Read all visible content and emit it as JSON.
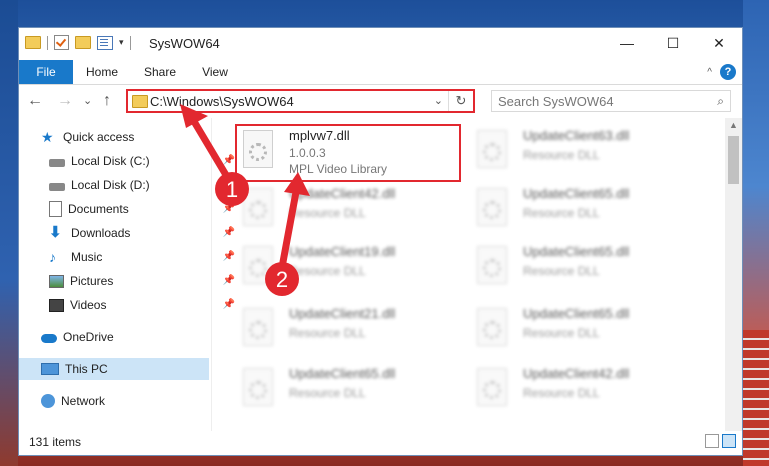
{
  "window": {
    "title": "SysWOW64",
    "minimize_glyph": "—",
    "maximize_glyph": "☐",
    "close_glyph": "✕"
  },
  "ribbon": {
    "tabs": [
      "File",
      "Home",
      "Share",
      "View"
    ],
    "help_glyph": "?",
    "collapse_glyph": "^"
  },
  "nav": {
    "back_glyph": "←",
    "forward_glyph": "→",
    "recent_glyph": "⌄",
    "up_glyph": "↑",
    "address": "C:\\Windows\\SysWOW64",
    "address_chevron": "⌄",
    "refresh_glyph": "↻",
    "search_placeholder": "Search SysWOW64",
    "search_glyph": "⌕"
  },
  "sidebar": {
    "items": [
      {
        "label": "Quick access",
        "icon": "star-icon"
      },
      {
        "label": "Local Disk (C:)",
        "icon": "disk-icon",
        "pinned": true
      },
      {
        "label": "Local Disk (D:)",
        "icon": "disk-icon",
        "pinned": true
      },
      {
        "label": "Documents",
        "icon": "document-icon",
        "pinned": true
      },
      {
        "label": "Downloads",
        "icon": "download-icon",
        "pinned": true
      },
      {
        "label": "Music",
        "icon": "music-icon",
        "pinned": true
      },
      {
        "label": "Pictures",
        "icon": "pictures-icon",
        "pinned": true
      },
      {
        "label": "Videos",
        "icon": "videos-icon",
        "pinned": true
      },
      {
        "label": "OneDrive",
        "icon": "cloud-icon"
      },
      {
        "label": "This PC",
        "icon": "computer-icon",
        "selected": true
      },
      {
        "label": "Network",
        "icon": "network-icon"
      }
    ]
  },
  "files": {
    "primary": {
      "name": "mplvw7.dll",
      "version": "1.0.0.3",
      "description": "MPL Video Library"
    },
    "blurred": [
      {
        "name": "UpdateClient63.dll",
        "type": "Resource DLL"
      },
      {
        "name": "UpdateClient42.dll",
        "type": "Resource DLL"
      },
      {
        "name": "UpdateClient65.dll",
        "type": "Resource DLL"
      },
      {
        "name": "UpdateClient19.dll",
        "type": "Resource DLL"
      },
      {
        "name": "UpdateClient65.dll",
        "type": "Resource DLL"
      },
      {
        "name": "UpdateClient21.dll",
        "type": "Resource DLL"
      },
      {
        "name": "UpdateClient65.dll",
        "type": "Resource DLL"
      },
      {
        "name": "UpdateClient65.dll",
        "type": "Resource DLL"
      },
      {
        "name": "UpdateClient42.dll",
        "type": "Resource DLL"
      }
    ]
  },
  "status": {
    "item_count": "131 items"
  },
  "annotations": {
    "step1": "1",
    "step2": "2",
    "color": "#e2282f"
  }
}
